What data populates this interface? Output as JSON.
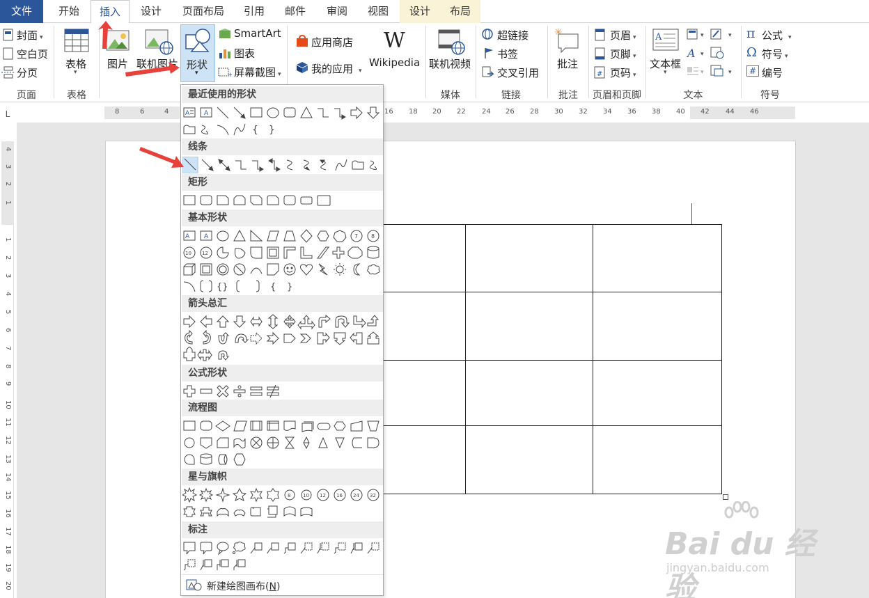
{
  "tabs": [
    {
      "label": "文件",
      "style": "file"
    },
    {
      "label": "开始",
      "style": ""
    },
    {
      "label": "插入",
      "style": "active"
    },
    {
      "label": "设计",
      "style": ""
    },
    {
      "label": "页面布局",
      "style": ""
    },
    {
      "label": "引用",
      "style": ""
    },
    {
      "label": "邮件",
      "style": ""
    },
    {
      "label": "审阅",
      "style": ""
    },
    {
      "label": "视图",
      "style": ""
    },
    {
      "label": "设计",
      "style": "ctx"
    },
    {
      "label": "布局",
      "style": "ctx"
    }
  ],
  "ribbon": {
    "pages": {
      "cover": "封面",
      "blank": "空白页",
      "break": "分页",
      "group": "页面"
    },
    "tables": {
      "table": "表格",
      "group": "表格"
    },
    "illustrations": {
      "picture": "图片",
      "online_picture": "联机图片",
      "shapes": "形状",
      "smartart": "SmartArt",
      "chart": "图表",
      "screenshot": "屏幕截图"
    },
    "apps": {
      "store": "应用商店",
      "my_apps": "我的应用",
      "wikipedia": "Wikipedia",
      "wiki_logo": "W"
    },
    "media": {
      "online_video": "联机视频",
      "group": "媒体"
    },
    "links": {
      "hyperlink": "超链接",
      "bookmark": "书签",
      "crossref": "交叉引用",
      "group": "链接"
    },
    "comments": {
      "comment": "批注",
      "group": "批注"
    },
    "header_footer": {
      "header": "页眉",
      "footer": "页脚",
      "page_number": "页码",
      "group": "页眉和页脚"
    },
    "text": {
      "textbox": "文本框",
      "group": "文本"
    },
    "symbols": {
      "equation": "公式",
      "symbol": "符号",
      "numbering": "编号",
      "group": "符号",
      "pi": "π",
      "omega": "Ω",
      "hash": "#"
    }
  },
  "ruler": {
    "h_labels": [
      "8",
      "6",
      "4",
      "16",
      "18",
      "20",
      "22",
      "24",
      "26",
      "28",
      "30",
      "32",
      "34",
      "36",
      "38",
      "40",
      "42",
      "44",
      "46"
    ],
    "v_labels": [
      "4",
      "3",
      "2",
      "1",
      "1",
      "2",
      "3",
      "4",
      "5",
      "6",
      "7",
      "8",
      "9",
      "10",
      "11",
      "12",
      "13",
      "14",
      "15",
      "16",
      "17",
      "18",
      "19",
      "20"
    ],
    "corner": "L"
  },
  "dropdown": {
    "sections": [
      {
        "id": "recent",
        "title": "最近使用的形状"
      },
      {
        "id": "lines",
        "title": "线条"
      },
      {
        "id": "rect",
        "title": "矩形"
      },
      {
        "id": "basic",
        "title": "基本形状"
      },
      {
        "id": "arrows",
        "title": "箭头总汇"
      },
      {
        "id": "equation",
        "title": "公式形状"
      },
      {
        "id": "flow",
        "title": "流程图"
      },
      {
        "id": "stars",
        "title": "星与旗帜"
      },
      {
        "id": "callouts",
        "title": "标注"
      }
    ],
    "new_canvas": "新建绘图画布(",
    "new_canvas_key": "N",
    "new_canvas_end": ")"
  },
  "table": {
    "rows": 4,
    "cols": 3
  },
  "watermark": {
    "brand": "Bai du 经验",
    "url": "jingyan.baidu.com"
  },
  "colors": {
    "file_tab": "#2b579a",
    "accent": "#2b579a",
    "arrow": "#e8413c",
    "context_tab": "#fbf3d8"
  }
}
